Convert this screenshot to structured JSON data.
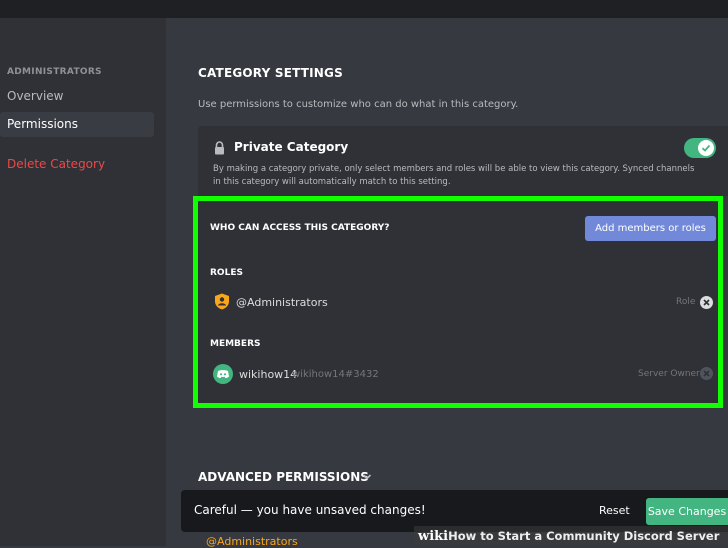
{
  "sidebar": {
    "header": "ADMINISTRATORS",
    "items": [
      {
        "label": "Overview"
      },
      {
        "label": "Permissions"
      },
      {
        "label": "Delete Category"
      }
    ]
  },
  "main": {
    "title": "CATEGORY SETTINGS",
    "description": "Use permissions to customize who can do what in this category."
  },
  "private_category": {
    "title": "Private Category",
    "description": "By making a category private, only select members and roles will be able to view this category. Synced channels in this category will automatically match to this setting.",
    "enabled": true
  },
  "access": {
    "title": "WHO CAN ACCESS THIS CATEGORY?",
    "add_button": "Add members or roles",
    "roles_label": "ROLES",
    "roles": [
      {
        "name": "@Administrators",
        "tag": "Role"
      }
    ],
    "members_label": "MEMBERS",
    "members": [
      {
        "name": "wikihow14",
        "handle": "wikihow14#3432",
        "tag": "Server Owner"
      }
    ]
  },
  "advanced": {
    "title": "ADVANCED PERMISSIONS"
  },
  "bottom_peek": "@Administrators",
  "unsaved": {
    "message": "Careful — you have unsaved changes!",
    "reset": "Reset",
    "save": "Save Changes"
  },
  "watermark": {
    "prefix": "wiki",
    "text": "How to Start a Community Discord Server"
  },
  "colors": {
    "highlight_border": "#11ff00",
    "toggle_on": "#43b581",
    "blurple": "#7289da",
    "danger": "#f04747",
    "role_icon": "#faa61a",
    "discord_avatar": "#43b581"
  }
}
